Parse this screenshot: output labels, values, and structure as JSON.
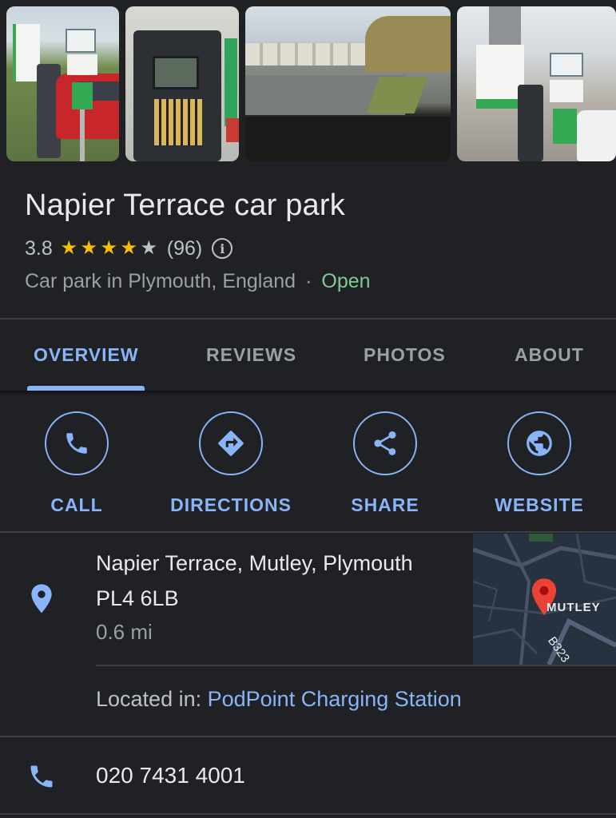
{
  "place": {
    "name": "Napier Terrace car park",
    "rating": "3.8",
    "stars_filled": 4,
    "stars_total": 5,
    "review_count": "(96)",
    "category": "Car park in Plymouth, England",
    "separator": "·",
    "status": "Open"
  },
  "photos": [
    {
      "name": "photo-signs-and-car"
    },
    {
      "name": "photo-parking-meter"
    },
    {
      "name": "photo-street-view"
    },
    {
      "name": "photo-charging-signs"
    }
  ],
  "tabs": [
    {
      "label": "OVERVIEW",
      "active": true
    },
    {
      "label": "REVIEWS",
      "active": false
    },
    {
      "label": "PHOTOS",
      "active": false
    },
    {
      "label": "ABOUT",
      "active": false
    }
  ],
  "actions": [
    {
      "label": "CALL",
      "icon": "phone-icon"
    },
    {
      "label": "DIRECTIONS",
      "icon": "directions-icon"
    },
    {
      "label": "SHARE",
      "icon": "share-icon"
    },
    {
      "label": "WEBSITE",
      "icon": "globe-icon"
    }
  ],
  "address": {
    "line1": "Napier Terrace, Mutley, Plymouth",
    "line2": "PL4 6LB",
    "distance": "0.6 mi",
    "located_label": "Located in: ",
    "located_link": "PodPoint Charging Station",
    "map_label": "MUTLEY",
    "map_road": "B323"
  },
  "phone": {
    "number": "020 7431 4001"
  },
  "colors": {
    "background": "#202124",
    "accent": "#8ab4f8",
    "star": "#fbbc04",
    "open": "#81c995",
    "pin": "#ea4335"
  }
}
